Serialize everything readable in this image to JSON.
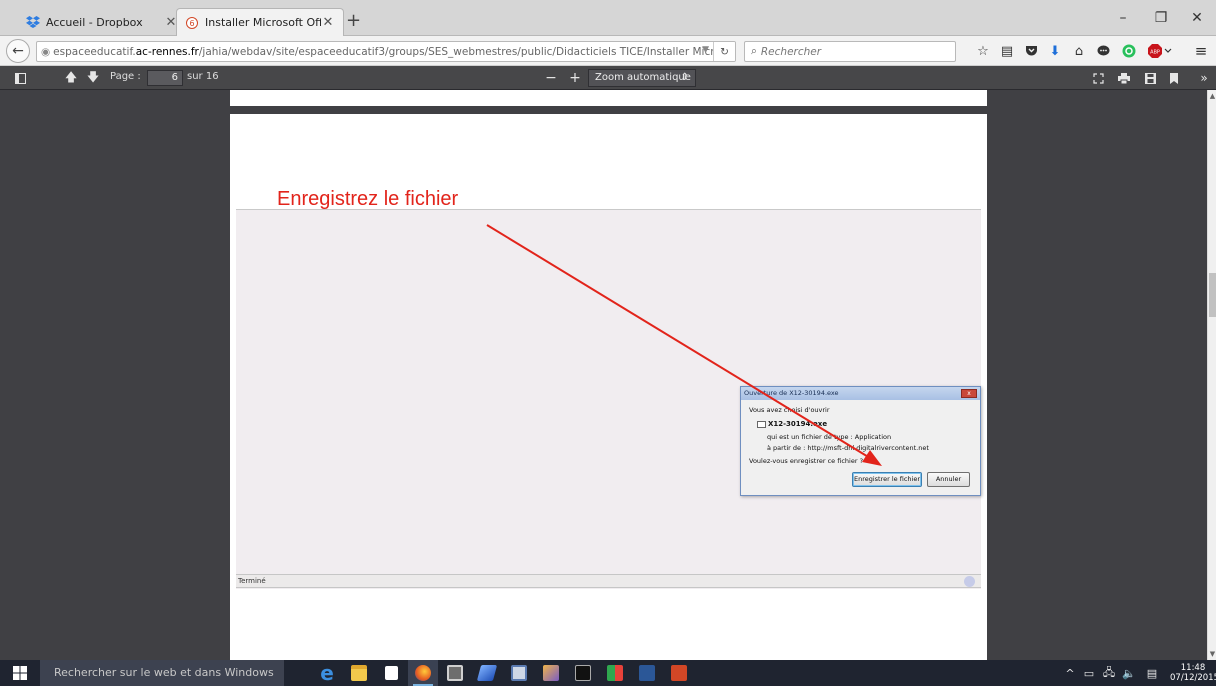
{
  "browser": {
    "tabs": [
      {
        "title": "Accueil - Dropbox",
        "icon": "dropbox-icon",
        "active": false
      },
      {
        "title": "Installer Microsoft Office....",
        "icon": "pdf-tab-icon",
        "active": true
      }
    ],
    "new_tab": "+",
    "window_controls": {
      "minimize": "–",
      "restore": "❐",
      "close": "✕"
    },
    "url": {
      "prefix": "espaceeducatif.",
      "domain": "ac-rennes.fr",
      "path": "/jahia/webdav/site/espaceeducatif3/groups/SES_webmestres/public/Didacticiels TICE/Installer Microsoft Office.p"
    },
    "search_placeholder": "Rechercher"
  },
  "pdf_toolbar": {
    "page_label": "Page :",
    "page_number": "6",
    "page_of": "sur 16",
    "zoom_minus": "−",
    "zoom_plus": "+",
    "zoom_value": "Zoom automatique"
  },
  "document": {
    "annotation_text": "Enregistrez le fichier",
    "status_text": "Terminé",
    "dialog": {
      "title": "Ouverture de X12-30194.exe",
      "intro": "Vous avez choisi d'ouvrir",
      "file_name": "X12-30194.exe",
      "type_line": "qui est un fichier de type : Application",
      "from_line": "à partir de : http://msft-dnl.digitalrivercontent.net",
      "question": "Voulez-vous enregistrer ce fichier ?",
      "save_button": "Enregistrer le fichier",
      "cancel_button": "Annuler",
      "close_glyph": "x"
    }
  },
  "taskbar": {
    "search_placeholder": "Rechercher sur le web et dans Windows",
    "time": "11:48",
    "date": "07/12/2015",
    "apps": [
      "edge-icon",
      "file-explorer-icon",
      "store-icon",
      "firefox-icon",
      "app-icon",
      "app-icon",
      "app-icon",
      "app-icon",
      "terminal-icon",
      "app-icon",
      "word-icon",
      "app-icon"
    ]
  },
  "colors": {
    "annotation_red": "#e2241b",
    "pdf_bg": "#404044",
    "taskbar": "#1f2430"
  }
}
